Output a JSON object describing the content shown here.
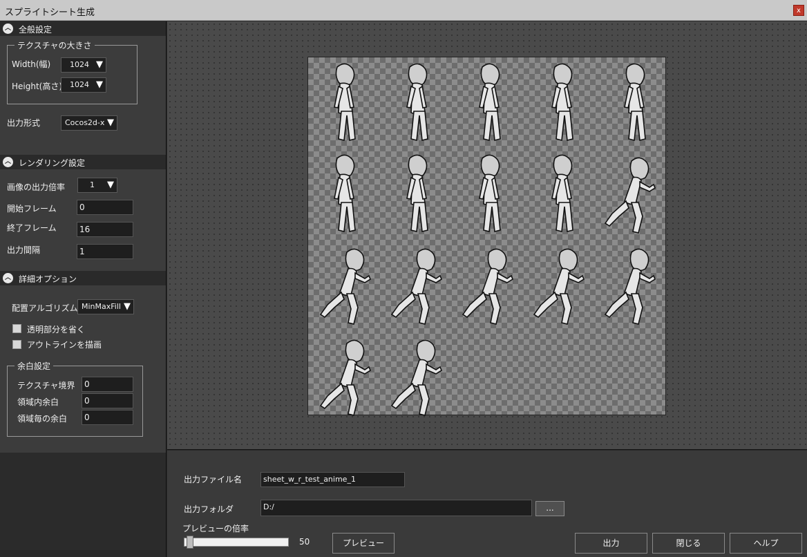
{
  "window": {
    "title": "スプライトシート生成",
    "close_label": "x"
  },
  "general": {
    "header": "全般設定",
    "texture_group": "テクスチャの大きさ",
    "width_label": "Width(幅)",
    "width_value": "1024",
    "height_label": "Height(高さ)",
    "height_value": "1024",
    "format_label": "出力形式",
    "format_value": "Cocos2d-x"
  },
  "rendering": {
    "header": "レンダリング設定",
    "scale_label": "画像の出力倍率",
    "scale_value": "1",
    "start_label": "開始フレーム",
    "start_value": "0",
    "end_label": "終了フレーム",
    "end_value": "16",
    "interval_label": "出力間隔",
    "interval_value": "1"
  },
  "detail": {
    "header": "詳細オプション",
    "algo_label": "配置アルゴリズム",
    "algo_value": "MinMaxFill",
    "trim_label": "透明部分を省く",
    "outline_label": "アウトラインを描画",
    "margin_group": "余白設定",
    "tex_border_label": "テクスチャ境界",
    "tex_border_value": "0",
    "inner_label": "領域内余白",
    "inner_value": "0",
    "each_label": "領域毎の余白",
    "each_value": "0"
  },
  "bottom": {
    "filename_label": "出力ファイル名",
    "filename_value": "sheet_w_r_test_anime_1",
    "folder_label": "出力フォルダ",
    "folder_value": "D:/",
    "browse_label": "...",
    "zoom_label": "プレビューの倍率",
    "zoom_value": "50",
    "preview_btn": "プレビュー",
    "output_btn": "出力",
    "close_btn": "閉じる",
    "help_btn": "ヘルプ"
  },
  "preview": {
    "sprite_count": 17
  }
}
